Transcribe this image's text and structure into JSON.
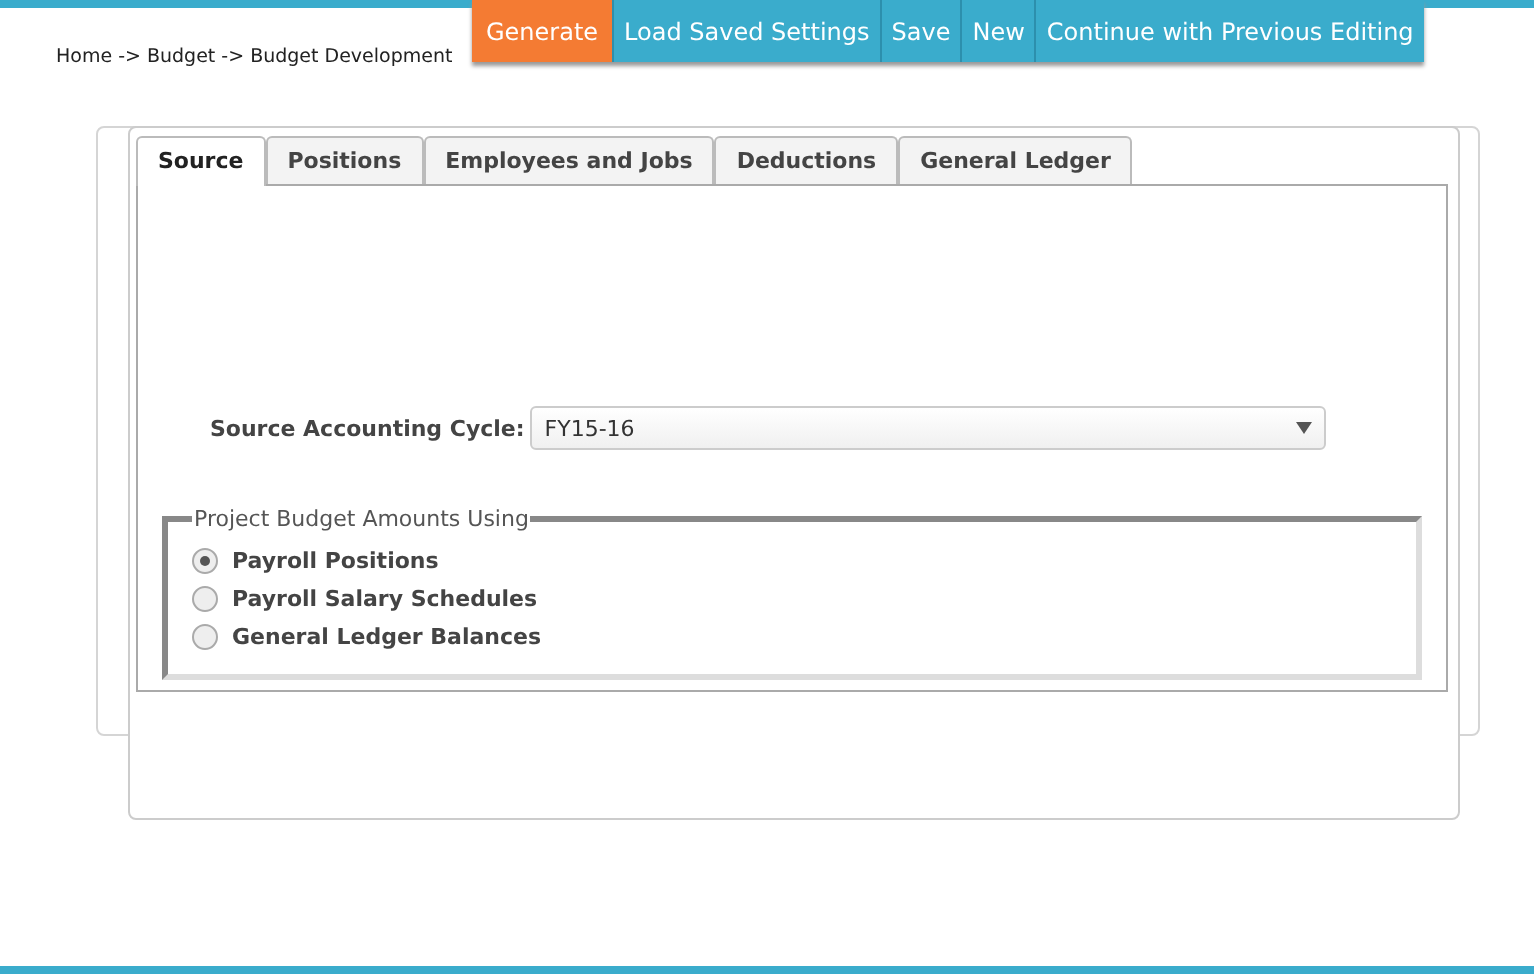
{
  "breadcrumb": "Home -> Budget -> Budget Development",
  "toolbar": [
    {
      "label": "Generate",
      "kind": "primary"
    },
    {
      "label": "Load Saved Settings",
      "kind": "normal"
    },
    {
      "label": "Save",
      "kind": "normal"
    },
    {
      "label": "New",
      "kind": "normal"
    },
    {
      "label": "Continue with Previous Editing",
      "kind": "normal"
    }
  ],
  "tabs": [
    {
      "label": "Source",
      "selected": true
    },
    {
      "label": "Positions",
      "selected": false
    },
    {
      "label": "Employees and Jobs",
      "selected": false
    },
    {
      "label": "Deductions",
      "selected": false
    },
    {
      "label": "General Ledger",
      "selected": false
    }
  ],
  "source_cycle": {
    "label": "Source Accounting Cycle:",
    "value": "FY15-16"
  },
  "budget_amounts": {
    "legend": "Project Budget Amounts Using",
    "options": [
      {
        "label": "Payroll Positions",
        "selected": true
      },
      {
        "label": "Payroll Salary Schedules",
        "selected": false
      },
      {
        "label": "General Ledger Balances",
        "selected": false
      }
    ]
  }
}
